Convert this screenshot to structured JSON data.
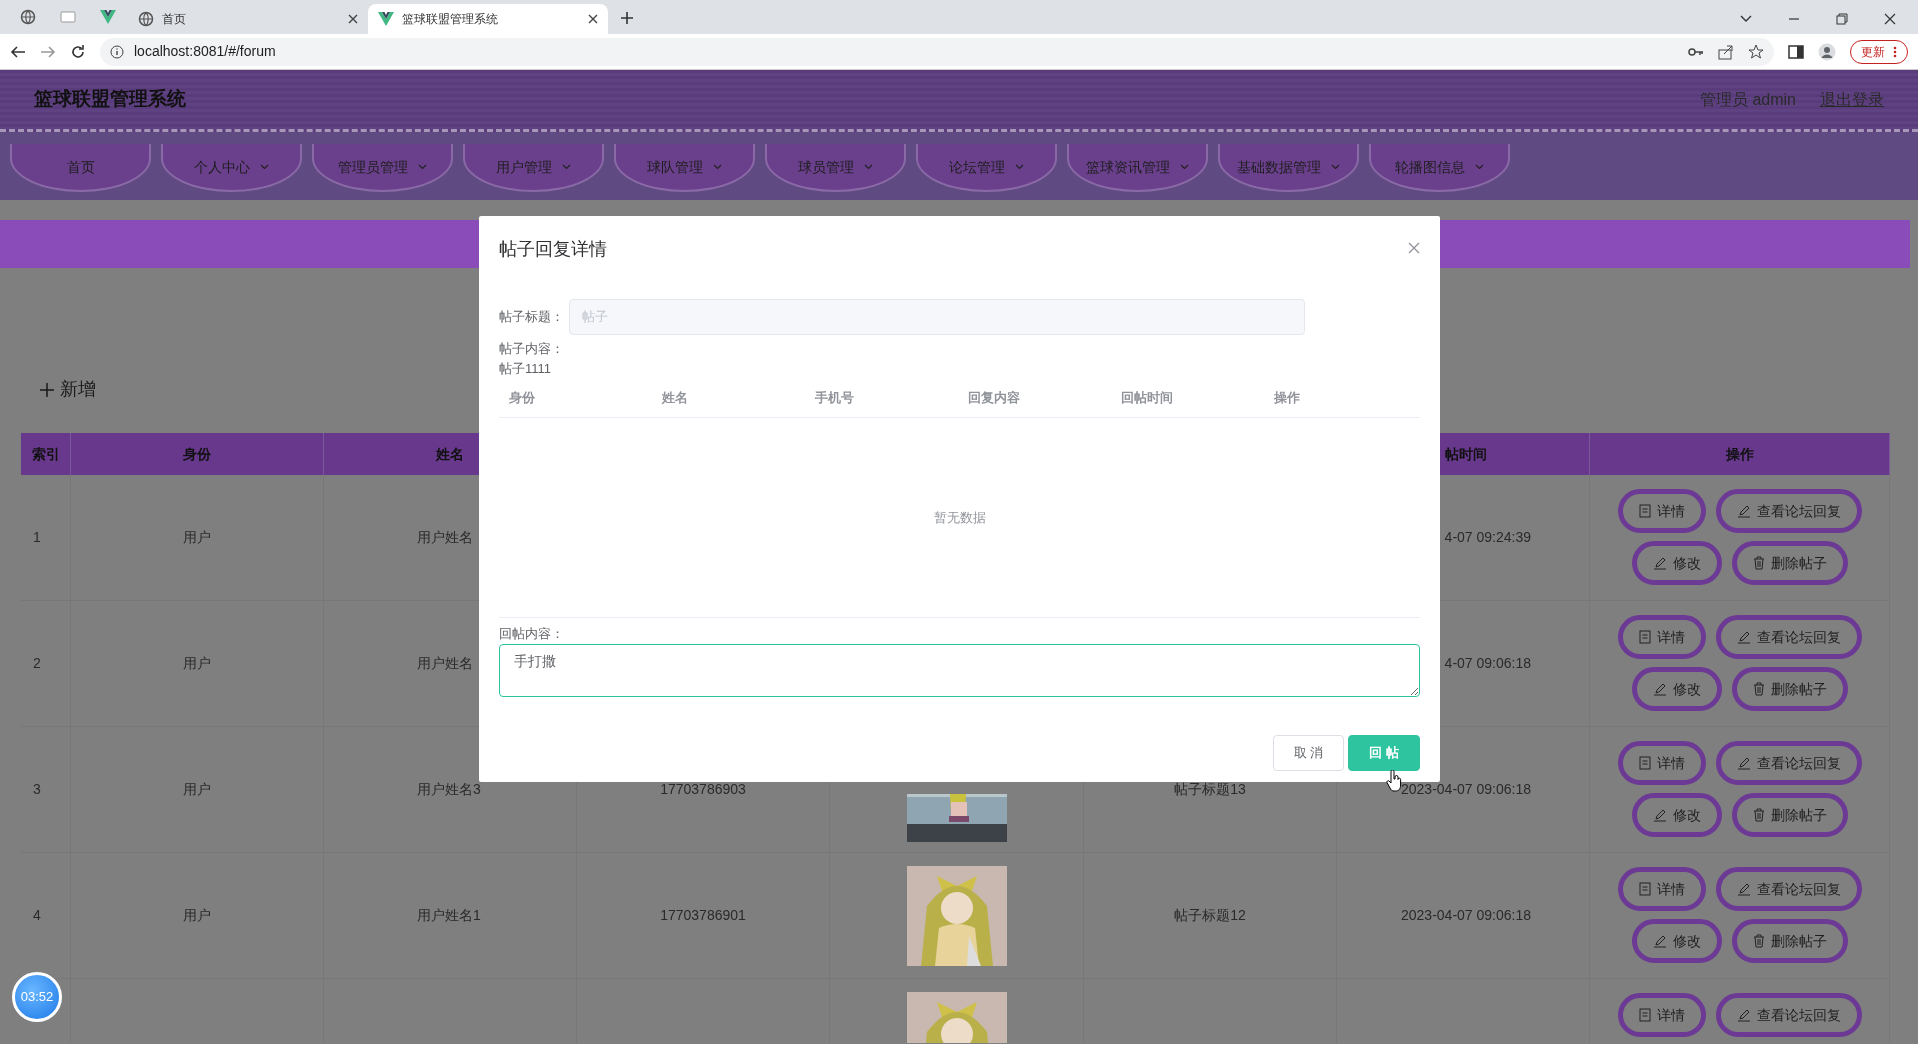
{
  "browser": {
    "tabs": [
      {
        "title": "首页",
        "selected": false
      },
      {
        "title": "篮球联盟管理系统",
        "selected": true
      }
    ],
    "url": "localhost:8081/#/forum",
    "update_button": "更新"
  },
  "app": {
    "title": "篮球联盟管理系统",
    "user": "管理员 admin",
    "logout": "退出登录"
  },
  "nav": [
    {
      "label": "首页",
      "dropdown": false
    },
    {
      "label": "个人中心",
      "dropdown": true
    },
    {
      "label": "管理员管理",
      "dropdown": true
    },
    {
      "label": "用户管理",
      "dropdown": true
    },
    {
      "label": "球队管理",
      "dropdown": true
    },
    {
      "label": "球员管理",
      "dropdown": true
    },
    {
      "label": "论坛管理",
      "dropdown": true
    },
    {
      "label": "篮球资讯管理",
      "dropdown": true
    },
    {
      "label": "基础数据管理",
      "dropdown": true
    },
    {
      "label": "轮播图信息",
      "dropdown": true
    }
  ],
  "add_button": "新增",
  "table": {
    "column_headers": {
      "index": "索引",
      "identity": "身份",
      "name": "姓名",
      "posted_time": "帖时间",
      "actions": "操作"
    },
    "rows": [
      {
        "index": "1",
        "identity": "用户",
        "name": "用户姓名",
        "posted_time": "4-07 09:24:39",
        "actions": [
          {
            "kind": "detail",
            "label": "详情"
          },
          {
            "kind": "replies",
            "label": "查看论坛回复"
          },
          {
            "kind": "edit",
            "label": "修改"
          },
          {
            "kind": "delete",
            "label": "删除帖子"
          }
        ]
      },
      {
        "index": "2",
        "identity": "用户",
        "name": "用户姓名",
        "posted_time": "4-07 09:06:18",
        "actions": [
          {
            "kind": "detail",
            "label": "详情"
          },
          {
            "kind": "replies",
            "label": "查看论坛回复"
          },
          {
            "kind": "edit",
            "label": "修改"
          },
          {
            "kind": "delete",
            "label": "删除帖子"
          }
        ]
      },
      {
        "index": "3",
        "identity": "用户",
        "name": "用户姓名3",
        "phone": "17703786903",
        "picture": {
          "kind": "picture"
        },
        "post_title": "帖子标题13",
        "posted_time": "2023-04-07 09:06:18",
        "actions": [
          {
            "kind": "detail",
            "label": "详情"
          },
          {
            "kind": "replies",
            "label": "查看论坛回复"
          },
          {
            "kind": "edit",
            "label": "修改"
          },
          {
            "kind": "delete",
            "label": "删除帖子"
          }
        ]
      },
      {
        "index": "4",
        "identity": "用户",
        "name": "用户姓名1",
        "phone": "17703786901",
        "picture": {
          "kind": "picture"
        },
        "post_title": "帖子标题12",
        "posted_time": "2023-04-07 09:06:18",
        "actions": [
          {
            "kind": "detail",
            "label": "详情"
          },
          {
            "kind": "replies",
            "label": "查看论坛回复"
          },
          {
            "kind": "edit",
            "label": "修改"
          },
          {
            "kind": "delete",
            "label": "删除帖子"
          }
        ]
      },
      {
        "picture": {
          "kind": "picture"
        },
        "actions": [
          {
            "kind": "detail",
            "label": "详情"
          },
          {
            "kind": "replies",
            "label": "查看论坛回复"
          }
        ]
      }
    ]
  },
  "modal": {
    "title": "帖子回复详情",
    "post_title_label": "帖子标题：",
    "post_title_value": "帖子",
    "post_title_disabled": true,
    "post_content_label": "帖子内容：",
    "post_content": "帖子1111",
    "reply_columns": [
      "身份",
      "姓名",
      "手机号",
      "回复内容",
      "回帖时间",
      "操作"
    ],
    "empty_text": "暂无数据",
    "reply_label": "回帖内容：",
    "reply_value": "手打撒",
    "buttons": [
      {
        "kind": "cancel",
        "label": "取 消"
      },
      {
        "kind": "primary",
        "label": "回 帖"
      }
    ]
  },
  "timer": "03:52"
}
